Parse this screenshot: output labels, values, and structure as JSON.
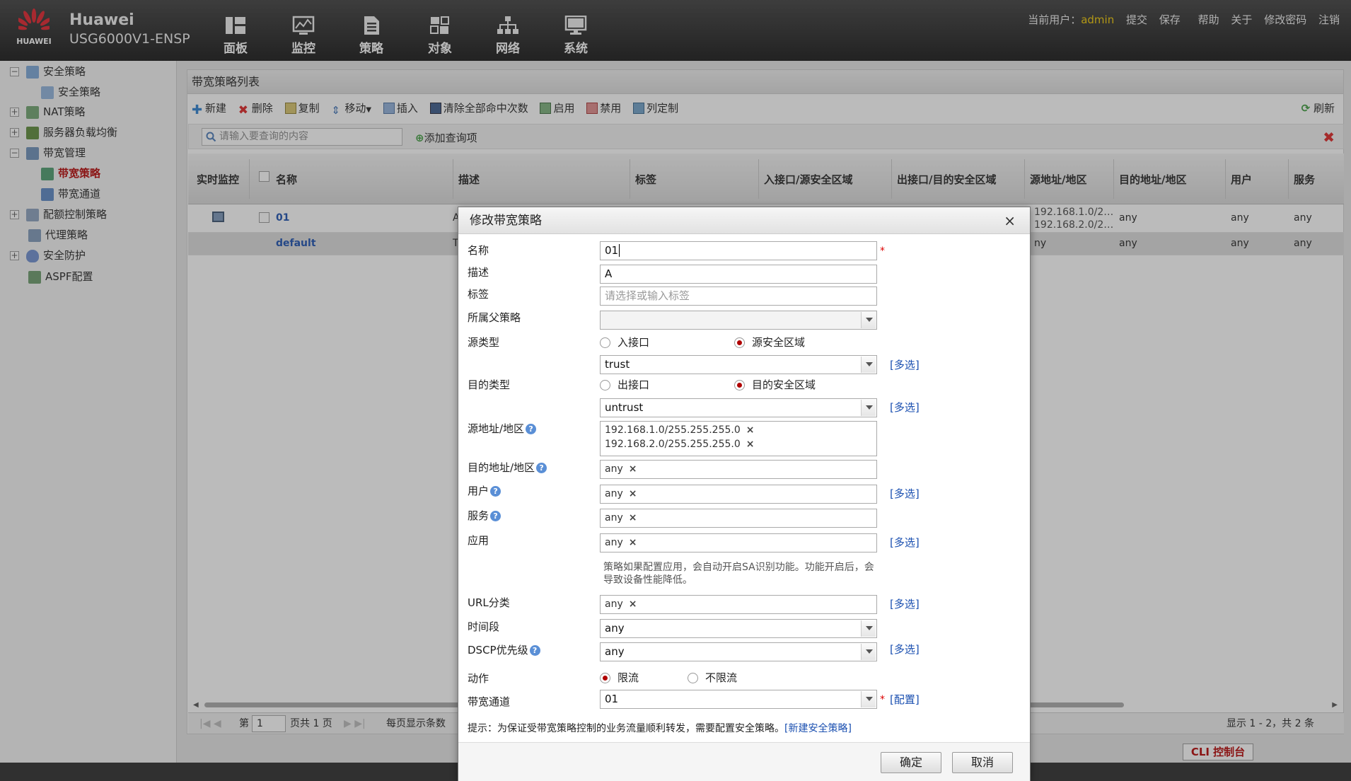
{
  "brand": {
    "logo_text": "HUAWEI",
    "title": "Huawei",
    "model": "USG6000V1-ENSP"
  },
  "nav": [
    {
      "label": "面板",
      "icon": "dashboard-icon"
    },
    {
      "label": "监控",
      "icon": "monitor-icon"
    },
    {
      "label": "策略",
      "icon": "policy-icon"
    },
    {
      "label": "对象",
      "icon": "object-icon"
    },
    {
      "label": "网络",
      "icon": "network-icon"
    },
    {
      "label": "系统",
      "icon": "system-icon"
    }
  ],
  "userbar": {
    "current_user_label": "当前用户：",
    "username": "admin",
    "submit": "提交",
    "save": "保存",
    "help": "帮助",
    "about": "关于",
    "change_password": "修改密码",
    "logout": "注销"
  },
  "tree": [
    {
      "label": "安全策略",
      "expander": "−"
    },
    {
      "label": "安全策略"
    },
    {
      "label": "NAT策略",
      "expander": "+"
    },
    {
      "label": "服务器负载均衡",
      "expander": "+"
    },
    {
      "label": "带宽管理",
      "expander": "−"
    },
    {
      "label": "带宽策略"
    },
    {
      "label": "带宽通道"
    },
    {
      "label": "配额控制策略",
      "expander": "+"
    },
    {
      "label": "代理策略"
    },
    {
      "label": "安全防护",
      "expander": "+"
    },
    {
      "label": "ASPF配置"
    }
  ],
  "main": {
    "title": "带宽策略列表",
    "toolbar": {
      "new": "新建",
      "delete": "删除",
      "copy": "复制",
      "move": "移动",
      "insert": "插入",
      "clear_hits": "清除全部命中次数",
      "enable": "启用",
      "disable": "禁用",
      "columns": "列定制",
      "refresh": "刷新"
    },
    "search_placeholder": "请输入要查询的内容",
    "add_query": "添加查询项",
    "columns": [
      "实时监控",
      "名称",
      "描述",
      "标签",
      "入接口/源安全区域",
      "出接口/目的安全区域",
      "源地址/地区",
      "目的地址/地区",
      "用户",
      "服务"
    ],
    "rows": [
      {
        "name": "01",
        "desc": "A",
        "src": "192.168.1.0/2…",
        "src2": "192.168.2.0/2…",
        "dst": "any",
        "user": "any",
        "service": "any"
      },
      {
        "name": "default",
        "desc": "T",
        "src": "ny",
        "dst": "any",
        "user": "any",
        "service": "any"
      }
    ],
    "pager": {
      "page_prefix": "第",
      "page_value": "1",
      "page_suffix": "页共 1 页",
      "per_page": "每页显示条数",
      "summary": "显示 1 - 2，共 2 条"
    }
  },
  "cli_console": "CLI 控制台",
  "dialog": {
    "title": "修改带宽策略",
    "close": "×",
    "name_label": "名称",
    "name_value": "01",
    "desc_label": "描述",
    "desc_value": "A",
    "tag_label": "标签",
    "tag_placeholder": "请选择或输入标签",
    "parent_label": "所属父策略",
    "src_type_label": "源类型",
    "src_opt1": "入接口",
    "src_opt2": "源安全区域",
    "src_zone": "trust",
    "dst_type_label": "目的类型",
    "dst_opt1": "出接口",
    "dst_opt2": "目的安全区域",
    "dst_zone": "untrust",
    "more": "[多选]",
    "src_addr_label": "源地址/地区",
    "src_addr_1": "192.168.1.0/255.255.255.0",
    "src_addr_2": "192.168.2.0/255.255.255.0",
    "dst_addr_label": "目的地址/地区",
    "dst_addr": "any",
    "user_label": "用户",
    "user": "any",
    "service_label": "服务",
    "service": "any",
    "app_label": "应用",
    "app": "any",
    "app_note": "策略如果配置应用，会自动开启SA识别功能。功能开启后，会导致设备性能降低。",
    "url_label": "URL分类",
    "url": "any",
    "time_label": "时间段",
    "time": "any",
    "dscp_label": "DSCP优先级",
    "dscp": "any",
    "action_label": "动作",
    "action_opt1": "限流",
    "action_opt2": "不限流",
    "channel_label": "带宽通道",
    "channel": "01",
    "configure": "[配置]",
    "tip": "提示：为保证受带宽策略控制的业务流量顺利转发，需要配置安全策略。",
    "tip_link": "[新建安全策略]",
    "ok": "确定",
    "cancel": "取消",
    "required_mark": "*"
  },
  "colors": {
    "accent_red": "#b50000",
    "link_blue": "#1a4fb0",
    "topbar": "#2a2a2a"
  }
}
